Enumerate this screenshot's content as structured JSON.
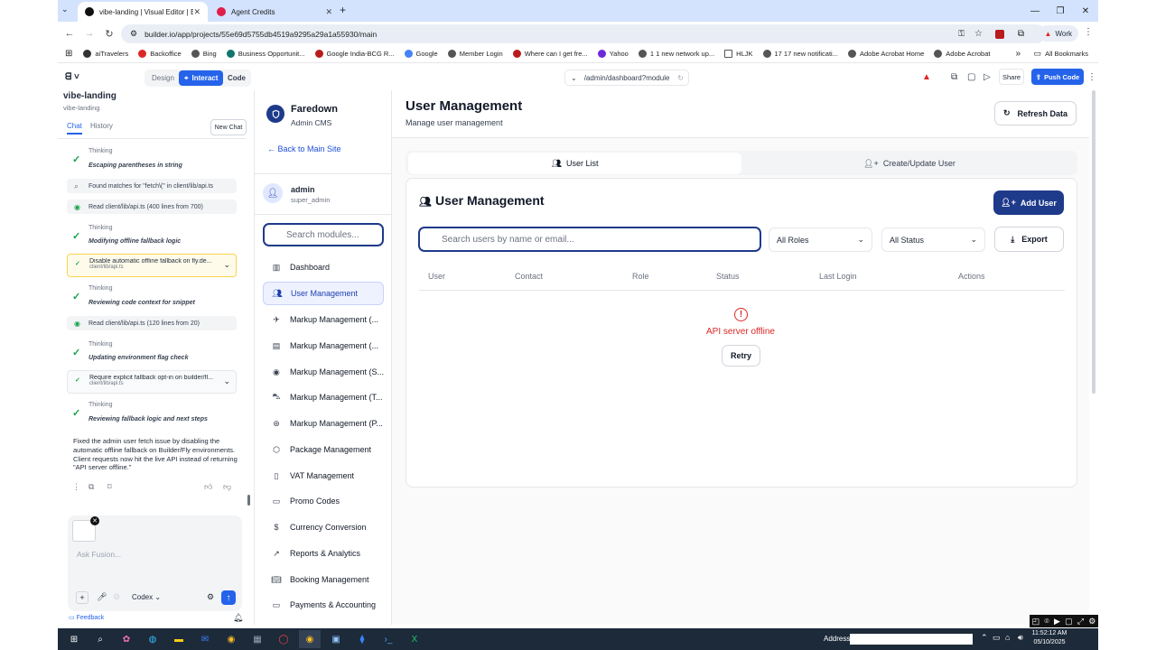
{
  "browser": {
    "tabs": [
      {
        "label": "vibe-landing | Visual Editor | Bu",
        "active": true
      },
      {
        "label": "Agent Credits",
        "active": false
      }
    ],
    "new_tab_symbol": "+",
    "url": "builder.io/app/projects/55e69d5755db4519a9295a29a1a55930/main",
    "profile_label": "Work",
    "bookmarks": [
      "aiTravelers",
      "Backoffice",
      "Bing",
      "Business Opportunit...",
      "Google India-BCG R...",
      "Google",
      "Member Login",
      "Where can I get fre...",
      "Yahoo",
      "1 1 new network up...",
      "HLJK",
      "17 17 new notificati...",
      "Adobe Acrobat Home",
      "Adobe Acrobat"
    ],
    "all_bookmarks_label": "All Bookmarks"
  },
  "builder": {
    "modes": [
      "Design",
      "Interact",
      "Code"
    ],
    "active_mode": "Interact",
    "route": "/admin/dashboard?module",
    "share_label": "Share",
    "push_label": "Push Code"
  },
  "chat": {
    "project_title": "vibe-landing",
    "project_subtitle": "vibe-landing",
    "tabs": [
      "Chat",
      "History"
    ],
    "new_chat_label": "New Chat",
    "thinking_label": "Thinking",
    "steps": [
      {
        "kind": "thinking",
        "text": "Escaping parentheses in string"
      },
      {
        "kind": "search",
        "text": "Found matches for \"fetch\\(\" in client/lib/api.ts"
      },
      {
        "kind": "read",
        "text": "Read client/lib/api.ts (400 lines from 700)"
      },
      {
        "kind": "thinking",
        "text": "Modifying offline fallback logic"
      },
      {
        "kind": "edit-warn",
        "text": "Disable automatic offline fallback on fly.de...",
        "file": "client/lib/api.ts"
      },
      {
        "kind": "thinking",
        "text": "Reviewing code context for snippet"
      },
      {
        "kind": "read",
        "text": "Read client/lib/api.ts (120 lines from 20)"
      },
      {
        "kind": "thinking",
        "text": "Updating environment flag check"
      },
      {
        "kind": "edit",
        "text": "Require explicit fallback opt-in on builder/fl...",
        "file": "client/lib/api.ts"
      },
      {
        "kind": "thinking",
        "text": "Reviewing fallback logic and next steps"
      }
    ],
    "summary": "Fixed the admin user fetch issue by disabling the automatic offline fallback on Builder/Fly environments. Client requests now hit the live API instead of returning \"API server offline.\"",
    "input_placeholder": "Ask Fusion...",
    "model_label": "Codex",
    "feedback_label": "Feedback"
  },
  "admin_sidebar": {
    "brand_title": "Faredown",
    "brand_subtitle": "Admin CMS",
    "back_label": "Back to Main Site",
    "user_name": "admin",
    "user_role": "super_admin",
    "search_placeholder": "Search modules...",
    "items": [
      {
        "label": "Dashboard",
        "icon": "bar-chart-icon"
      },
      {
        "label": "User Management",
        "icon": "users-icon",
        "active": true
      },
      {
        "label": "Markup Management (...",
        "icon": "plane-icon"
      },
      {
        "label": "Markup Management (...",
        "icon": "building-icon"
      },
      {
        "label": "Markup Management (S...",
        "icon": "eye-icon"
      },
      {
        "label": "Markup Management (T...",
        "icon": "car-icon"
      },
      {
        "label": "Markup Management (P...",
        "icon": "package-icon"
      },
      {
        "label": "Package Management",
        "icon": "box-icon"
      },
      {
        "label": "VAT Management",
        "icon": "receipt-icon"
      },
      {
        "label": "Promo Codes",
        "icon": "ticket-icon"
      },
      {
        "label": "Currency Conversion",
        "icon": "dollar-icon"
      },
      {
        "label": "Reports & Analytics",
        "icon": "trend-icon"
      },
      {
        "label": "Booking Management",
        "icon": "book-icon"
      },
      {
        "label": "Payments & Accounting",
        "icon": "card-icon"
      }
    ]
  },
  "main": {
    "page_title": "User Management",
    "page_subtitle": "Manage user management",
    "refresh_label": "Refresh Data",
    "tabs": [
      "User List",
      "Create/Update User"
    ],
    "card_title": "User Management",
    "add_user_label": "Add User",
    "search_placeholder": "Search users by name or email...",
    "roles_filter": "All Roles",
    "status_filter": "All Status",
    "export_label": "Export",
    "columns": [
      "User",
      "Contact",
      "Role",
      "Status",
      "Last Login",
      "Actions"
    ],
    "error_text": "API server offline",
    "retry_label": "Retry"
  },
  "taskbar": {
    "address_label": "Address",
    "time": "11:52:12 AM",
    "date": "05/10/2025"
  },
  "colors": {
    "primary": "#1e3a8a",
    "accent_blue": "#2563eb",
    "error": "#dc2626",
    "success": "#16a34a"
  }
}
